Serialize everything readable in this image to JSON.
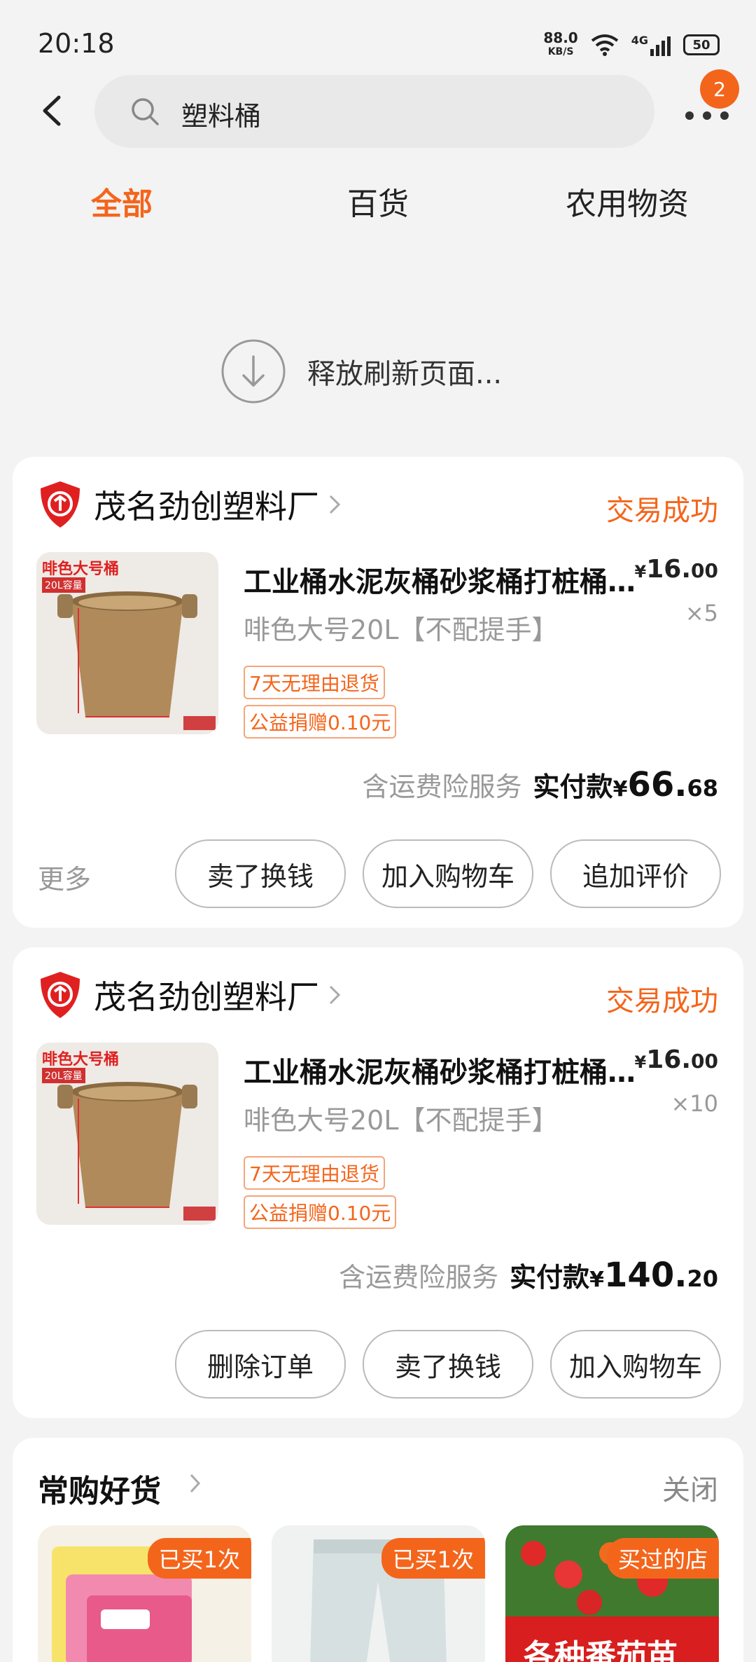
{
  "status_bar": {
    "time": "20:18",
    "net_speed_value": "88.0",
    "net_speed_unit": "KB/S",
    "signal_label": "4G",
    "battery": "50"
  },
  "search": {
    "query": "塑料桶",
    "notification_count": "2"
  },
  "tabs": [
    {
      "label": "全部",
      "active": true
    },
    {
      "label": "百货",
      "active": false
    },
    {
      "label": "农用物资",
      "active": false
    }
  ],
  "refresh": {
    "text": "释放刷新页面..."
  },
  "orders": [
    {
      "shop_name": "茂名劲创塑料厂",
      "status": "交易成功",
      "product_title": "工业桶水泥灰桶砂浆桶打桩桶...",
      "spec": "啡色大号20L【不配提手】",
      "tags": [
        "7天无理由退货",
        "公益捐赠0.10元"
      ],
      "price_int": "16.",
      "price_dec": "00",
      "qty": "×5",
      "insurance": "含运费险服务",
      "total_label": "实付款",
      "total_int": "66.",
      "total_dec": "68",
      "more": "更多",
      "buttons": [
        "卖了换钱",
        "加入购物车",
        "追加评价"
      ],
      "image_label": "啡色大号桶",
      "image_sub": "20L容量"
    },
    {
      "shop_name": "茂名劲创塑料厂",
      "status": "交易成功",
      "product_title": "工业桶水泥灰桶砂浆桶打桩桶...",
      "spec": "啡色大号20L【不配提手】",
      "tags": [
        "7天无理由退货",
        "公益捐赠0.10元"
      ],
      "price_int": "16.",
      "price_dec": "00",
      "qty": "×10",
      "insurance": "含运费险服务",
      "total_label": "实付款",
      "total_int": "140.",
      "total_dec": "20",
      "buttons": [
        "删除订单",
        "卖了换钱",
        "加入购物车"
      ],
      "image_label": "啡色大号桶",
      "image_sub": "20L容量"
    }
  ],
  "recommend": {
    "title": "常购好货",
    "close": "关闭",
    "items": [
      {
        "badge": "已买1次"
      },
      {
        "badge": "已买1次"
      },
      {
        "badge": "买过的店",
        "caption": "各种番茄苗"
      }
    ]
  },
  "colors": {
    "accent": "#f4651c"
  }
}
